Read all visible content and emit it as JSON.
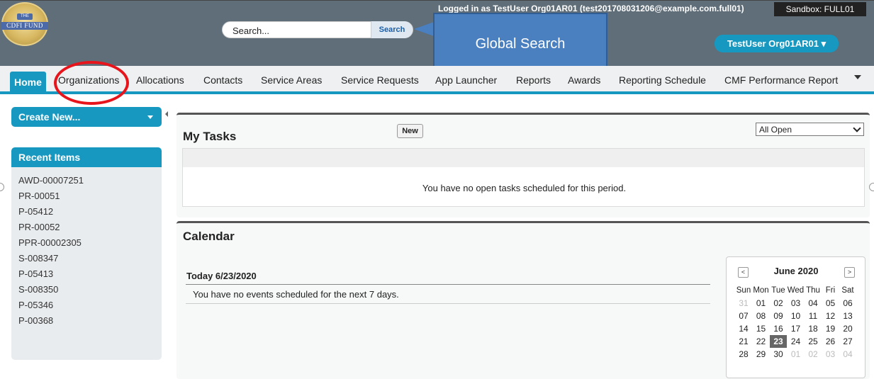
{
  "header": {
    "logo_text": "CDFI FUND",
    "logo_top_text": "THE",
    "login_text": "Logged in as TestUser Org01AR01 (test201708031206@example.com.full01)",
    "sandbox_label": "Sandbox:  FULL01",
    "search_placeholder": "Search...",
    "search_button": "Search",
    "callout": "Global Search",
    "user_menu": "TestUser Org01AR01 ▾"
  },
  "tabs": [
    {
      "label": "Home",
      "active": true
    },
    {
      "label": "Organizations"
    },
    {
      "label": "Allocations"
    },
    {
      "label": "Contacts"
    },
    {
      "label": "Service Areas"
    },
    {
      "label": "Service Requests"
    },
    {
      "label": "App Launcher"
    },
    {
      "label": "Reports"
    },
    {
      "label": "Awards"
    },
    {
      "label": "Reporting Schedule"
    },
    {
      "label": "CMF Performance Report"
    }
  ],
  "sidebar": {
    "create_new": "Create New...",
    "recent_title": "Recent Items",
    "recent_items": [
      "AWD-00007251",
      "PR-00051",
      "P-05412",
      "PR-00052",
      "PPR-00002305",
      "S-008347",
      "P-05413",
      "S-008350",
      "P-05346",
      "P-00368"
    ]
  },
  "tasks": {
    "title": "My Tasks",
    "new_button": "New",
    "filter_value": "All Open",
    "empty_message": "You have no open tasks scheduled for this period."
  },
  "calendar": {
    "title": "Calendar",
    "today_label": "Today 6/23/2020",
    "no_events": "You have no events scheduled for the next 7 days.",
    "mini": {
      "prev": "<",
      "next": ">",
      "month": "June 2020",
      "weekdays": [
        "Sun",
        "Mon",
        "Tue",
        "Wed",
        "Thu",
        "Fri",
        "Sat"
      ],
      "weeks": [
        [
          "31",
          "01",
          "02",
          "03",
          "04",
          "05",
          "06"
        ],
        [
          "07",
          "08",
          "09",
          "10",
          "11",
          "12",
          "13"
        ],
        [
          "14",
          "15",
          "16",
          "17",
          "18",
          "19",
          "20"
        ],
        [
          "21",
          "22",
          "23",
          "24",
          "25",
          "26",
          "27"
        ],
        [
          "28",
          "29",
          "30",
          "01",
          "02",
          "03",
          "04"
        ]
      ],
      "today": "23"
    }
  }
}
